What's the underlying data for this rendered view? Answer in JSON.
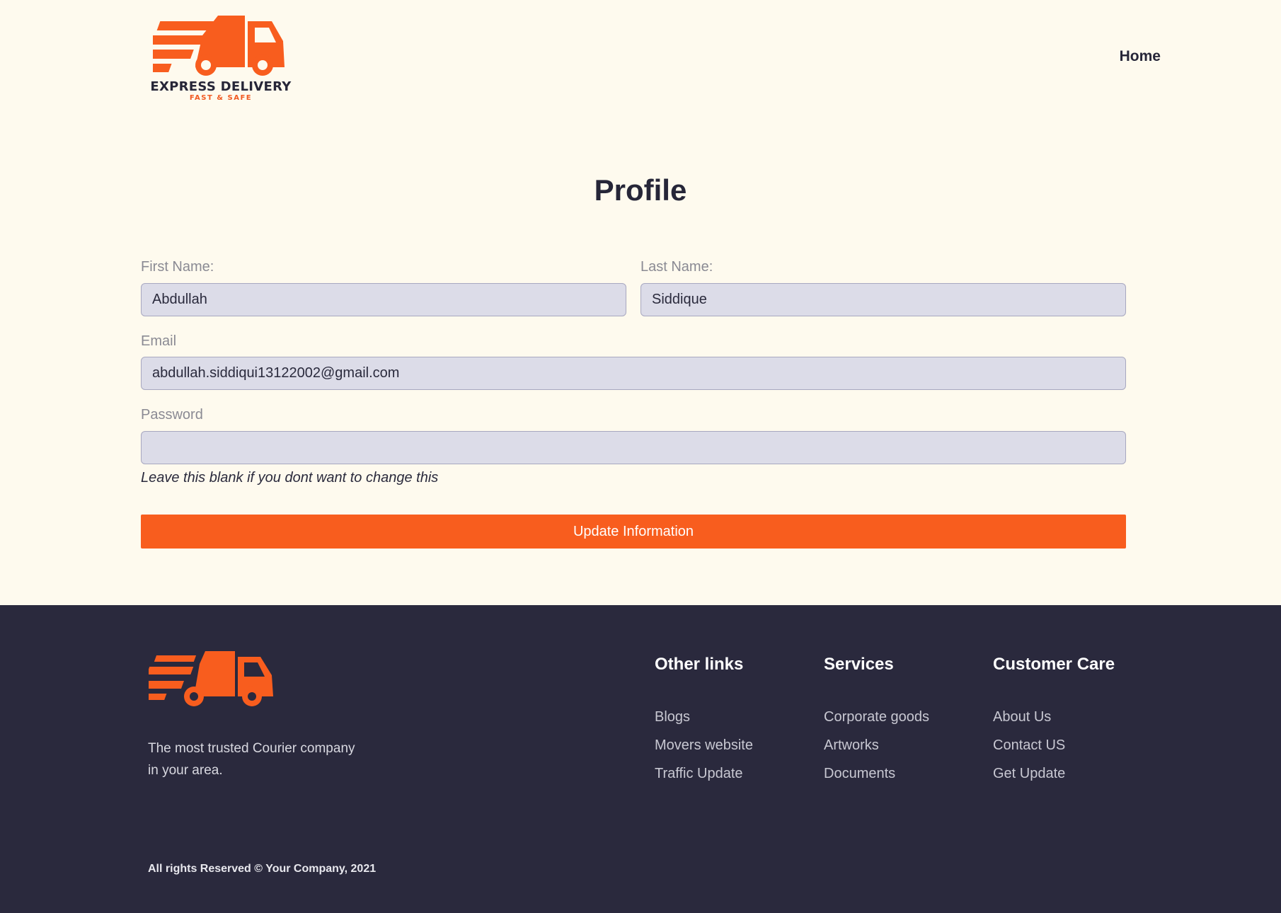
{
  "brand": {
    "name": "EXPRESS DELIVERY",
    "tagline": "FAST & SAFE",
    "accent_color": "#f85d1e",
    "logo_icon": "delivery-truck-icon"
  },
  "nav": {
    "home": "Home"
  },
  "profile": {
    "title": "Profile",
    "first_name": {
      "label": "First Name:",
      "value": "Abdullah"
    },
    "last_name": {
      "label": "Last Name:",
      "value": "Siddique"
    },
    "email": {
      "label": "Email",
      "value": "abdullah.siddiqui13122002@gmail.com"
    },
    "password": {
      "label": "Password",
      "value": "",
      "hint": "Leave this blank if you dont want to change this"
    },
    "submit_label": "Update Information"
  },
  "footer": {
    "tagline": "The most trusted Courier company in your area.",
    "columns": [
      {
        "title": "Other links",
        "links": [
          "Blogs",
          "Movers website",
          "Traffic Update"
        ]
      },
      {
        "title": "Services",
        "links": [
          "Corporate goods",
          "Artworks",
          "Documents"
        ]
      },
      {
        "title": "Customer Care",
        "links": [
          "About Us",
          "Contact US",
          "Get Update"
        ]
      }
    ],
    "copyright": "All rights Reserved © Your Company, 2021",
    "background_color": "#2a293d"
  }
}
